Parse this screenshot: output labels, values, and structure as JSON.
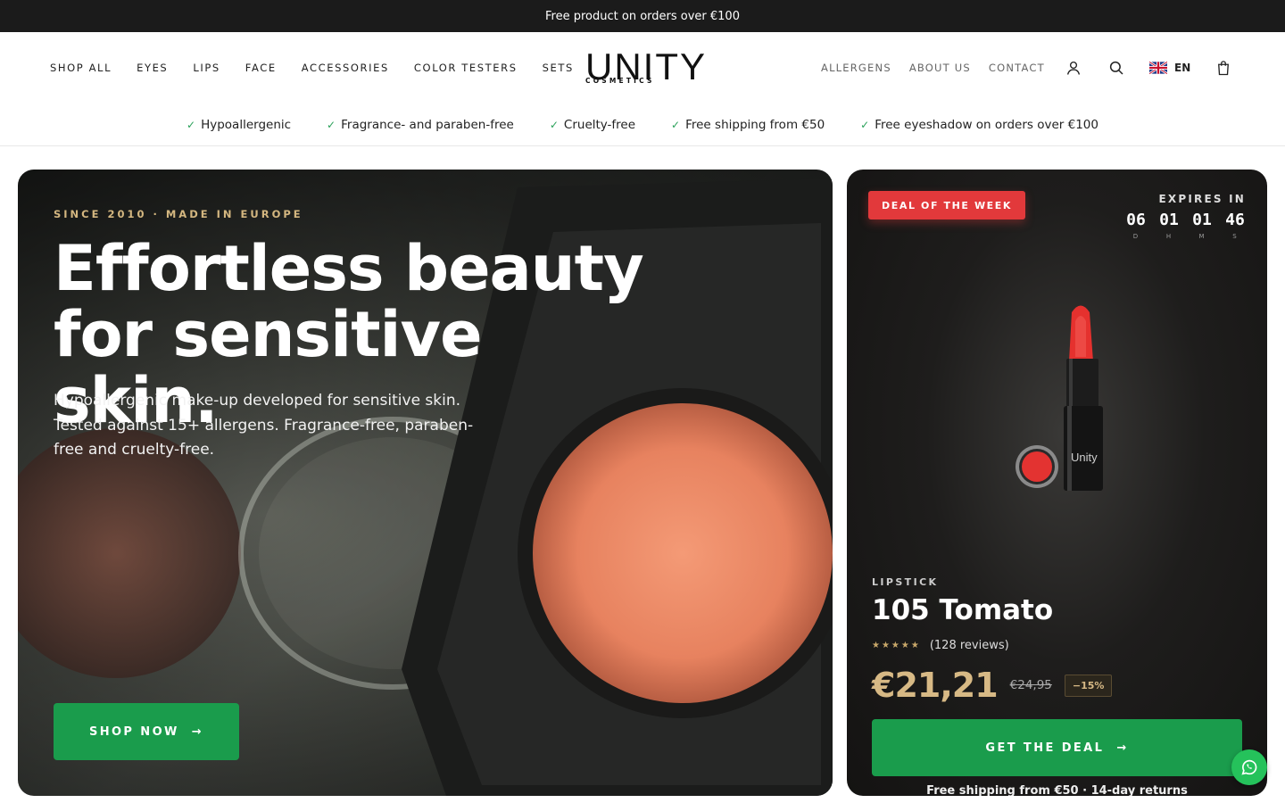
{
  "announcement": "Free product on orders over €100",
  "nav_left": [
    "SHOP ALL",
    "EYES",
    "LIPS",
    "FACE",
    "ACCESSORIES",
    "COLOR TESTERS",
    "SETS"
  ],
  "logo": {
    "wordmark": "UNITY",
    "subtitle": "COSMETICS"
  },
  "nav_right": [
    "ALLERGENS",
    "ABOUT US",
    "CONTACT"
  ],
  "icons": {
    "account": "user-icon",
    "search": "search-icon",
    "language_flag": "uk-flag-icon",
    "cart": "bag-icon"
  },
  "language": "EN",
  "usps": [
    "Hypoallergenic",
    "Fragrance- and paraben-free",
    "Cruelty-free",
    "Free shipping from €50",
    "Free eyeshadow on orders over €100"
  ],
  "hero": {
    "eyebrow": "SINCE 2010 · MADE IN EUROPE",
    "title_line1": "Effortless beauty",
    "title_line2": "for sensitive skin.",
    "description": "Hypoallergenic make-up developed for sensitive skin. Tested against 15+ allergens. Fragrance-free, paraben-free and cruelty-free.",
    "button": "SHOP NOW"
  },
  "deal": {
    "badge": "DEAL OF THE WEEK",
    "expires_label": "EXPIRES IN",
    "timer": [
      {
        "value": "06",
        "unit": "D"
      },
      {
        "value": "01",
        "unit": "H"
      },
      {
        "value": "01",
        "unit": "M"
      },
      {
        "value": "46",
        "unit": "S"
      }
    ],
    "category": "LIPSTICK",
    "product_name": "105 Tomato",
    "stars": "★★★★★",
    "reviews": "(128 reviews)",
    "price": "€21,21",
    "old_price": "€24,95",
    "discount": "−15%",
    "button": "GET THE DEAL",
    "shipping_note": "Free shipping from €50 · 14-day returns"
  },
  "colors": {
    "accent_green": "#1a9c4c",
    "badge_red": "#e2393b",
    "gold": "#d7b985"
  }
}
